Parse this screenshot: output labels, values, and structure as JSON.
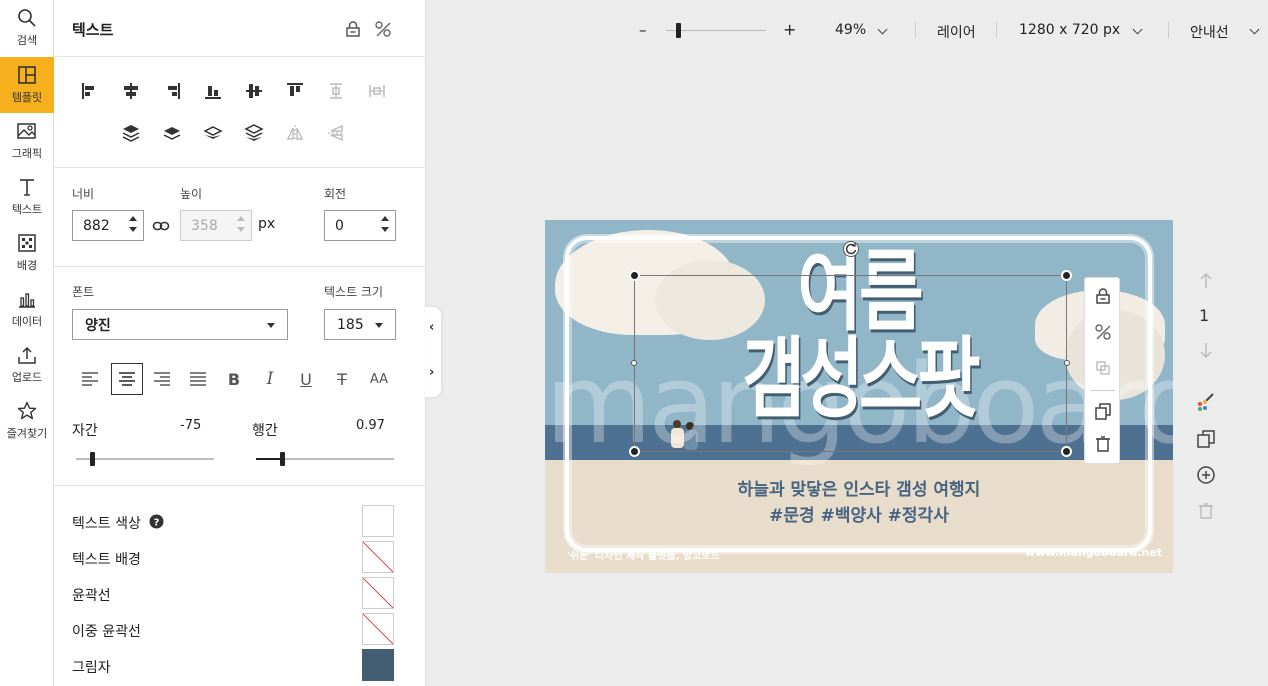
{
  "nav": {
    "items": [
      {
        "label": "검색"
      },
      {
        "label": "템플릿"
      },
      {
        "label": "그래픽"
      },
      {
        "label": "텍스트"
      },
      {
        "label": "배경"
      },
      {
        "label": "데이터"
      },
      {
        "label": "업로드"
      },
      {
        "label": "즐겨찾기"
      }
    ],
    "active_color": "#f7b01d"
  },
  "panel": {
    "title": "텍스트",
    "size": {
      "width_label": "너비",
      "width_value": "882",
      "height_label": "높이",
      "height_value": "358",
      "unit": "px",
      "rotation_label": "회전",
      "rotation_value": "0"
    },
    "font": {
      "font_label": "폰트",
      "font_value": "양진",
      "size_label": "텍스트 크기",
      "size_value": "185"
    },
    "spacing": {
      "letter_label": "자간",
      "letter_value": "-75",
      "line_label": "행간",
      "line_value": "0.97"
    },
    "styles": [
      {
        "label": "텍스트 색상",
        "color": "#ffffff"
      },
      {
        "label": "텍스트 배경",
        "color": "none"
      },
      {
        "label": "윤곽선",
        "color": "none"
      },
      {
        "label": "이중 윤곽선",
        "color": "none"
      },
      {
        "label": "그림자",
        "color": "#435e73"
      }
    ]
  },
  "topbar": {
    "zoom_minus": "–",
    "zoom_plus": "+",
    "zoom_level": "49%",
    "zoom_fraction": 0.1,
    "layer_label": "레이어",
    "canvas_size": "1280 x 720 px",
    "guide_label": "안내선"
  },
  "canvas": {
    "title_line1": "여름",
    "title_line2": "갬성스팟",
    "watermark": "mangoboard",
    "subtitle_line1": "하늘과 맞닿은 인스타 갬성 여행지",
    "subtitle_line2": "#문경 #백양사 #정각사",
    "credit": "'쉬운' 디자인 제작 플랫폼, 망고보드",
    "site": "www.mangoboard.net",
    "sky_color": "#90b6c8",
    "sea_color": "#4f7191",
    "sand_color": "#e8dccb"
  },
  "pages": {
    "current": "1"
  }
}
